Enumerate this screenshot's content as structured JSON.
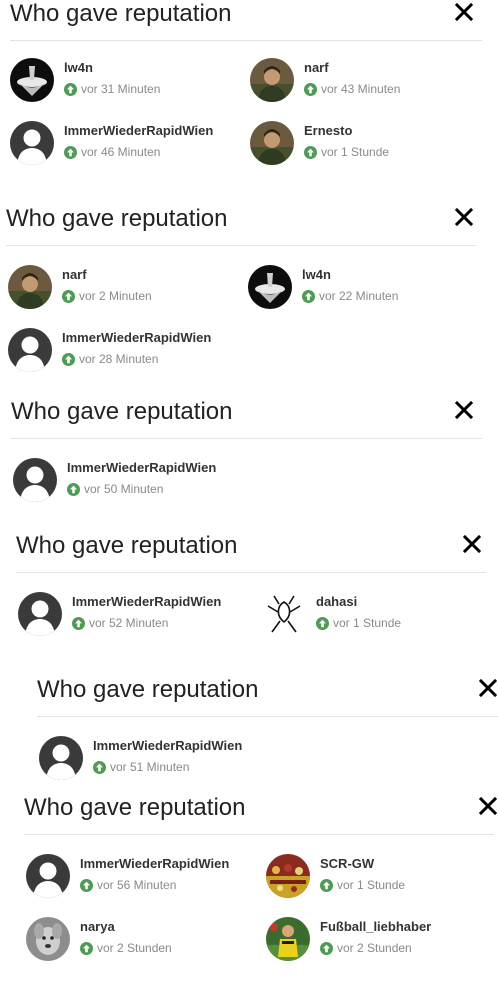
{
  "panels": [
    {
      "title": "Who gave reputation",
      "entries": [
        {
          "user": "lw4n",
          "time": "vor 31 Minuten",
          "avatar_icon": "spinning-top-icon"
        },
        {
          "user": "narf",
          "time": "vor 43 Minuten",
          "avatar_icon": "photo-person-icon"
        },
        {
          "user": "ImmerWiederRapidWien",
          "time": "vor 46 Minuten",
          "avatar_icon": "default-user-icon"
        },
        {
          "user": "Ernesto",
          "time": "vor 1 Stunde",
          "avatar_icon": "photo-person-icon"
        }
      ]
    },
    {
      "title": "Who gave reputation",
      "entries": [
        {
          "user": "narf",
          "time": "vor 2 Minuten",
          "avatar_icon": "photo-person-icon"
        },
        {
          "user": "lw4n",
          "time": "vor 22 Minuten",
          "avatar_icon": "spinning-top-icon"
        },
        {
          "user": "ImmerWiederRapidWien",
          "time": "vor 28 Minuten",
          "avatar_icon": "default-user-icon"
        }
      ]
    },
    {
      "title": "Who gave reputation",
      "entries": [
        {
          "user": "ImmerWiederRapidWien",
          "time": "vor 50 Minuten",
          "avatar_icon": "default-user-icon"
        }
      ]
    },
    {
      "title": "Who gave reputation",
      "entries": [
        {
          "user": "ImmerWiederRapidWien",
          "time": "vor 52 Minuten",
          "avatar_icon": "default-user-icon"
        },
        {
          "user": "dahasi",
          "time": "vor 1 Stunde",
          "avatar_icon": "stick-figure-icon"
        }
      ]
    },
    {
      "title": "Who gave reputation",
      "entries": [
        {
          "user": "ImmerWiederRapidWien",
          "time": "vor 51 Minuten",
          "avatar_icon": "default-user-icon"
        }
      ]
    },
    {
      "title": "Who gave reputation",
      "entries": [
        {
          "user": "ImmerWiederRapidWien",
          "time": "vor 56 Minuten",
          "avatar_icon": "default-user-icon"
        },
        {
          "user": "SCR-GW",
          "time": "vor 1 Stunde",
          "avatar_icon": "photo-crowd-icon"
        },
        {
          "user": "narya",
          "time": "vor 2 Stunden",
          "avatar_icon": "photo-dog-icon"
        },
        {
          "user": "Fußball_liebhaber",
          "time": "vor 2 Stunden",
          "avatar_icon": "photo-player-icon"
        }
      ]
    }
  ],
  "colors": {
    "upvote": "#4f9a55",
    "title": "#222222",
    "username": "#333333",
    "time": "#8a8a8a",
    "rule": "#e3e3e3"
  }
}
